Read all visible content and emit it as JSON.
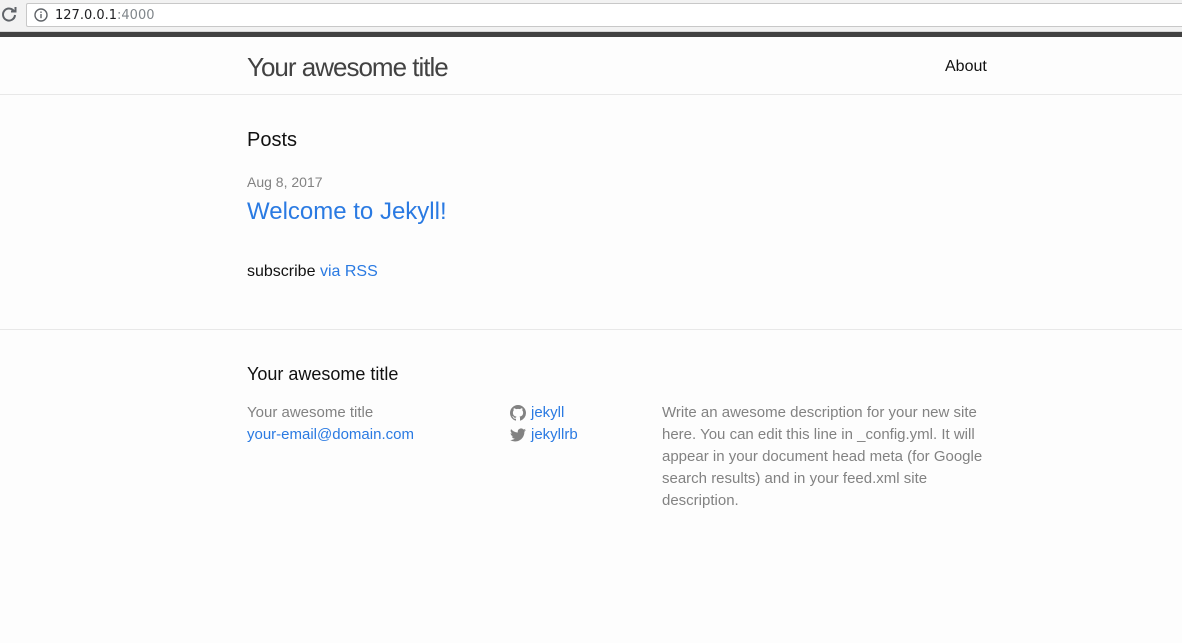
{
  "browser": {
    "url_host": "127.0.0.1",
    "url_port": ":4000",
    "icons": [
      "reload-icon",
      "info-icon"
    ]
  },
  "header": {
    "site_title": "Your awesome title",
    "nav": [
      {
        "label": "About"
      }
    ]
  },
  "main": {
    "heading": "Posts",
    "posts": [
      {
        "date": "Aug 8, 2017",
        "title": "Welcome to Jekyll!"
      }
    ],
    "rss_prefix": "subscribe",
    "rss_link": "via RSS"
  },
  "footer": {
    "heading": "Your awesome title",
    "col1": {
      "name": "Your awesome title",
      "email": "your-email@domain.com"
    },
    "social": [
      {
        "icon": "github-icon",
        "username": "jekyll"
      },
      {
        "icon": "twitter-icon",
        "username": "jekyllrb"
      }
    ],
    "description": "Write an awesome description for your new site here. You can edit this line in _config.yml. It will appear in your document head meta (for Google search results) and in your feed.xml site description."
  },
  "colors": {
    "link": "#2a7ae2",
    "muted": "#828282",
    "title": "#424242",
    "background": "#fdfdfd"
  }
}
